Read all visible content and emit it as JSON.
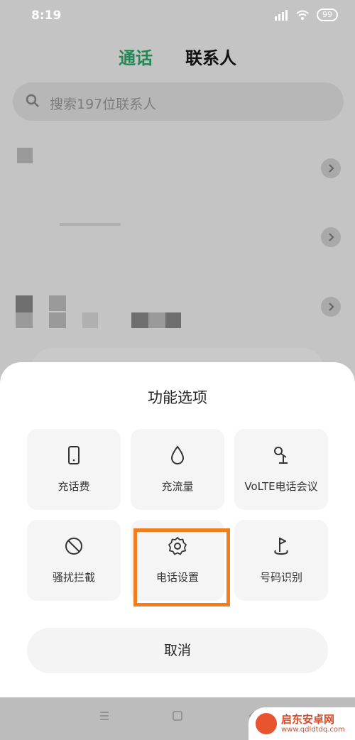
{
  "status": {
    "time": "8:19",
    "battery": "99"
  },
  "tabs": {
    "calls": "通话",
    "contacts": "联系人"
  },
  "search": {
    "placeholder": "搜索197位联系人"
  },
  "sheet": {
    "title": "功能选项",
    "options": [
      {
        "label": "充话费",
        "icon": "phone-icon"
      },
      {
        "label": "充流量",
        "icon": "droplet-icon"
      },
      {
        "label": "VoLTE电话会议",
        "icon": "microphone-icon"
      },
      {
        "label": "骚扰拦截",
        "icon": "block-icon"
      },
      {
        "label": "电话设置",
        "icon": "gear-icon"
      },
      {
        "label": "号码识别",
        "icon": "flag-pin-icon"
      }
    ],
    "cancel": "取消"
  },
  "watermark": {
    "name": "启东安卓网",
    "url": "www.qdldtdq.com"
  },
  "colors": {
    "accent": "#1f8a55",
    "highlight": "#f07d1f"
  }
}
